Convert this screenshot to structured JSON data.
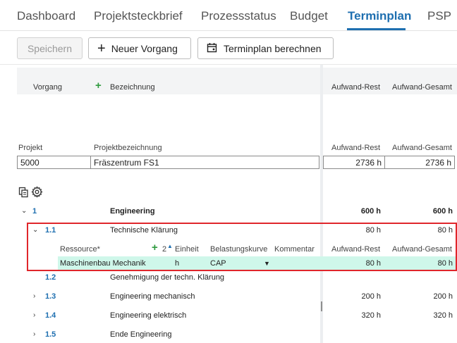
{
  "tabs": [
    {
      "label": "Dashboard"
    },
    {
      "label": "Projektsteckbrief"
    },
    {
      "label": "Prozessstatus"
    },
    {
      "label": "Budget"
    },
    {
      "label": "Terminplan"
    },
    {
      "label": "PSP"
    }
  ],
  "toolbar": {
    "save_label": "Speichern",
    "new_task_label": "Neuer Vorgang",
    "calc_label": "Terminplan berechnen"
  },
  "grid_header": {
    "vorgang": "Vorgang",
    "bezeichnung": "Bezeichnung",
    "aufwand_rest": "Aufwand-Rest",
    "aufwand_gesamt": "Aufwand-Gesamt"
  },
  "project": {
    "projekt_label": "Projekt",
    "bezeichnung_label": "Projektbezeichnung",
    "rest_label": "Aufwand-Rest",
    "gesamt_label": "Aufwand-Gesamt",
    "projekt_value": "5000",
    "bezeichnung_value": "Fräszentrum FS1",
    "rest_value": "2736 h",
    "gesamt_value": "2736 h"
  },
  "rows": [
    {
      "code": "1",
      "name": "Engineering",
      "rest": "600 h",
      "gesamt": "600 h"
    },
    {
      "code": "1.1",
      "name": "Technische Klärung",
      "rest": "80 h",
      "gesamt": "80 h"
    },
    {
      "code": "1.2",
      "name": "Genehmigung der techn. Klärung",
      "rest": "",
      "gesamt": ""
    },
    {
      "code": "1.3",
      "name": "Engineering mechanisch",
      "rest": "200 h",
      "gesamt": "200 h"
    },
    {
      "code": "1.4",
      "name": "Engineering elektrisch",
      "rest": "320 h",
      "gesamt": "320 h"
    },
    {
      "code": "1.5",
      "name": "Ende Engineering",
      "rest": "",
      "gesamt": ""
    }
  ],
  "resource": {
    "header_resource": "Ressource*",
    "header_sort": "2",
    "header_einheit": "Einheit",
    "header_kurve": "Belastungskurve",
    "header_kommentar": "Kommentar",
    "header_rest": "Aufwand-Rest",
    "header_gesamt": "Aufwand-Gesamt",
    "name": "Maschinenbau Mechanik",
    "einheit": "h",
    "kurve": "CAP",
    "rest": "80 h",
    "gesamt": "80 h"
  },
  "icons": {
    "copy": "copy-icon",
    "settings": "gear-icon",
    "plus": "plus-icon",
    "calendar": "calendar-icon"
  },
  "colors": {
    "accent": "#1e6fb0",
    "highlight_border": "#e0262b",
    "resource_row": "#cff7ea",
    "plus_green": "#2e9a3e"
  }
}
